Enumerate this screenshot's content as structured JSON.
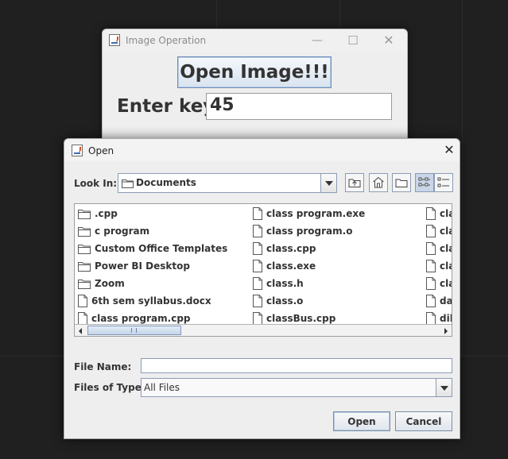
{
  "image_window": {
    "title": "Image Operation",
    "open_button_label": "Open Image!!!",
    "enter_key_label": "Enter key",
    "key_value": "45"
  },
  "dialog": {
    "title": "Open",
    "look_in_label": "Look In:",
    "look_in_value": "Documents",
    "toolbar_icons": [
      "up-one-level-icon",
      "home-icon",
      "new-folder-icon",
      "list-view-icon",
      "details-view-icon"
    ],
    "files_col1": [
      {
        "name": ".cpp",
        "icon": "folder-icon"
      },
      {
        "name": "c program",
        "icon": "folder-icon"
      },
      {
        "name": "Custom Office Templates",
        "icon": "folder-icon"
      },
      {
        "name": "Power BI Desktop",
        "icon": "folder-icon"
      },
      {
        "name": "Zoom",
        "icon": "folder-icon"
      },
      {
        "name": "6th sem syllabus.docx",
        "icon": "file-icon"
      },
      {
        "name": "class program.cpp",
        "icon": "file-icon"
      }
    ],
    "files_col2": [
      {
        "name": "class program.exe",
        "icon": "file-icon"
      },
      {
        "name": "class program.o",
        "icon": "file-icon"
      },
      {
        "name": "class.cpp",
        "icon": "file-icon"
      },
      {
        "name": "class.exe",
        "icon": "file-icon"
      },
      {
        "name": "class.h",
        "icon": "file-icon"
      },
      {
        "name": "class.o",
        "icon": "file-icon"
      },
      {
        "name": "classBus.cpp",
        "icon": "file-icon"
      }
    ],
    "files_col3": [
      {
        "name": "cla",
        "icon": "file-icon"
      },
      {
        "name": "cla",
        "icon": "file-icon"
      },
      {
        "name": "cla",
        "icon": "file-icon"
      },
      {
        "name": "cla",
        "icon": "file-icon"
      },
      {
        "name": "cla",
        "icon": "file-icon"
      },
      {
        "name": "da",
        "icon": "file-icon"
      },
      {
        "name": "dik",
        "icon": "file-icon"
      }
    ],
    "file_name_label": "File Name:",
    "file_name_value": "",
    "files_of_type_label": "Files of Type:",
    "files_of_type_value": "All Files",
    "open_button": "Open",
    "cancel_button": "Cancel"
  }
}
